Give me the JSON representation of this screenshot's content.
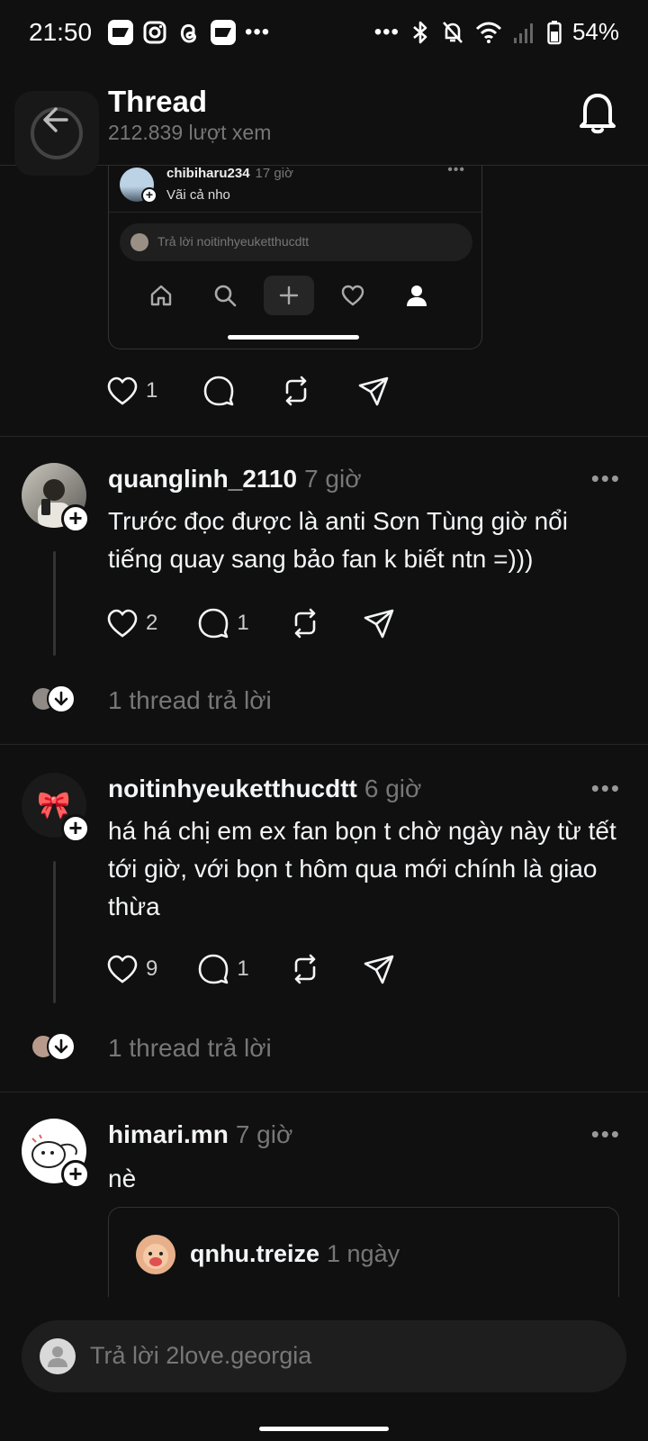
{
  "status_bar": {
    "time": "21:50",
    "battery": "54%",
    "icons": [
      "mail-app-icon",
      "instagram-icon",
      "threads-icon",
      "mail-app-icon",
      "more-dots-icon",
      "more-dots-icon",
      "bluetooth-icon",
      "mute-icon",
      "wifi-icon",
      "signal-icon",
      "battery-icon"
    ]
  },
  "header": {
    "title": "Thread",
    "views": "212.839 lượt xem"
  },
  "embedded_screenshot": {
    "username": "chibiharu234",
    "time": "17 giờ",
    "text": "Vãi cả nho",
    "reply_placeholder": "Trả lời noitinhyeuketthucdtt",
    "nav_icons": [
      "home-icon",
      "search-icon",
      "plus-icon",
      "heart-icon",
      "profile-icon"
    ]
  },
  "top_post_actions": {
    "likes": "1"
  },
  "posts": [
    {
      "username": "quanglinh_2110",
      "time": "7 giờ",
      "text": "Trước đọc được là anti Sơn Tùng giờ nổi tiếng quay sang bảo fan k biết ntn =)))",
      "likes": "2",
      "comments": "1",
      "replies": "1 thread trả lời"
    },
    {
      "username": "noitinhyeuketthucdtt",
      "time": "6 giờ",
      "text": "há há chị em ex fan bọn t chờ ngày này từ tết tới giờ, với bọn t hôm qua mới chính là giao thừa",
      "likes": "9",
      "comments": "1",
      "replies": "1 thread trả lời",
      "avatar_emoji": "🎀"
    },
    {
      "username": "himari.mn",
      "time": "7 giờ",
      "text": "nè",
      "quote": {
        "username": "qnhu.treize",
        "time": "1 ngày"
      }
    }
  ],
  "composer": {
    "placeholder": "Trả lời 2love.georgia"
  },
  "colors": {
    "background": "#101010",
    "text": "#f3f5f7",
    "muted": "#777777"
  }
}
